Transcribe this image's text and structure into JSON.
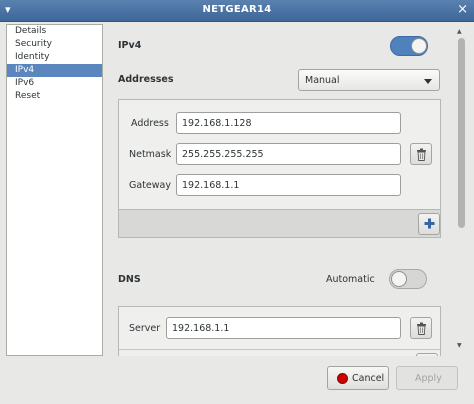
{
  "window": {
    "title": "NETGEAR14"
  },
  "sidebar": {
    "items": [
      {
        "label": "Details"
      },
      {
        "label": "Security"
      },
      {
        "label": "Identity"
      },
      {
        "label": "IPv4",
        "selected": true
      },
      {
        "label": "IPv6"
      },
      {
        "label": "Reset"
      }
    ]
  },
  "ipv4": {
    "heading": "IPv4",
    "enabled": true,
    "addresses_label": "Addresses",
    "method": "Manual",
    "address_label": "Address",
    "address_value": "192.168.1.128",
    "netmask_label": "Netmask",
    "netmask_value": "255.255.255.255",
    "gateway_label": "Gateway",
    "gateway_value": "192.168.1.1"
  },
  "dns": {
    "heading": "DNS",
    "automatic_label": "Automatic",
    "automatic_enabled": false,
    "server_label": "Server",
    "server_value": "192.168.1.1"
  },
  "buttons": {
    "cancel": "Cancel",
    "apply": "Apply"
  },
  "colors": {
    "accent": "#4f81bd",
    "selection": "#5b87be",
    "titlebar": "#3d6699",
    "cancel_icon": "#cc0000"
  }
}
